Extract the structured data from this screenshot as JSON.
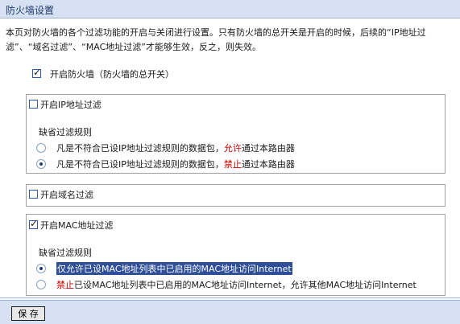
{
  "header": {
    "title": "防火墙设置"
  },
  "description": "本页对防火墙的各个过滤功能的开启与关闭进行设置。只有防火墙的总开关是开启的时候，后续的“IP地址过滤”、“域名过滤”、“MAC地址过滤”才能够生效，反之，则失效。",
  "master_switch": {
    "label": "开启防火墙（防火墙的总开关）",
    "checked": true
  },
  "ip_filter": {
    "label": "开启IP地址过滤",
    "checked": false,
    "rule_title": "缺省过滤规则",
    "options": [
      {
        "prefix": "凡是不符合已设IP地址过滤规则的数据包，",
        "keyword": "允许",
        "suffix": "通过本路由器",
        "selected": false
      },
      {
        "prefix": "凡是不符合已设IP地址过滤规则的数据包，",
        "keyword": "禁止",
        "suffix": "通过本路由器",
        "selected": true
      }
    ]
  },
  "domain_filter": {
    "label": "开启域名过滤",
    "checked": false
  },
  "mac_filter": {
    "label": "开启MAC地址过滤",
    "checked": true,
    "rule_title": "缺省过滤规则",
    "options": [
      {
        "text": "仅允许已设MAC地址列表中已启用的MAC地址访问Internet",
        "selected": true
      },
      {
        "keyword": "禁止",
        "suffix": "已设MAC地址列表中已启用的MAC地址访问Internet，允许其他MAC地址访问Internet",
        "selected": false
      }
    ]
  },
  "footer": {
    "save_label": "保 存"
  },
  "colors": {
    "header_bg": "#d6e2f3",
    "accent": "#2f4f98",
    "warning_red": "#cc0000"
  }
}
